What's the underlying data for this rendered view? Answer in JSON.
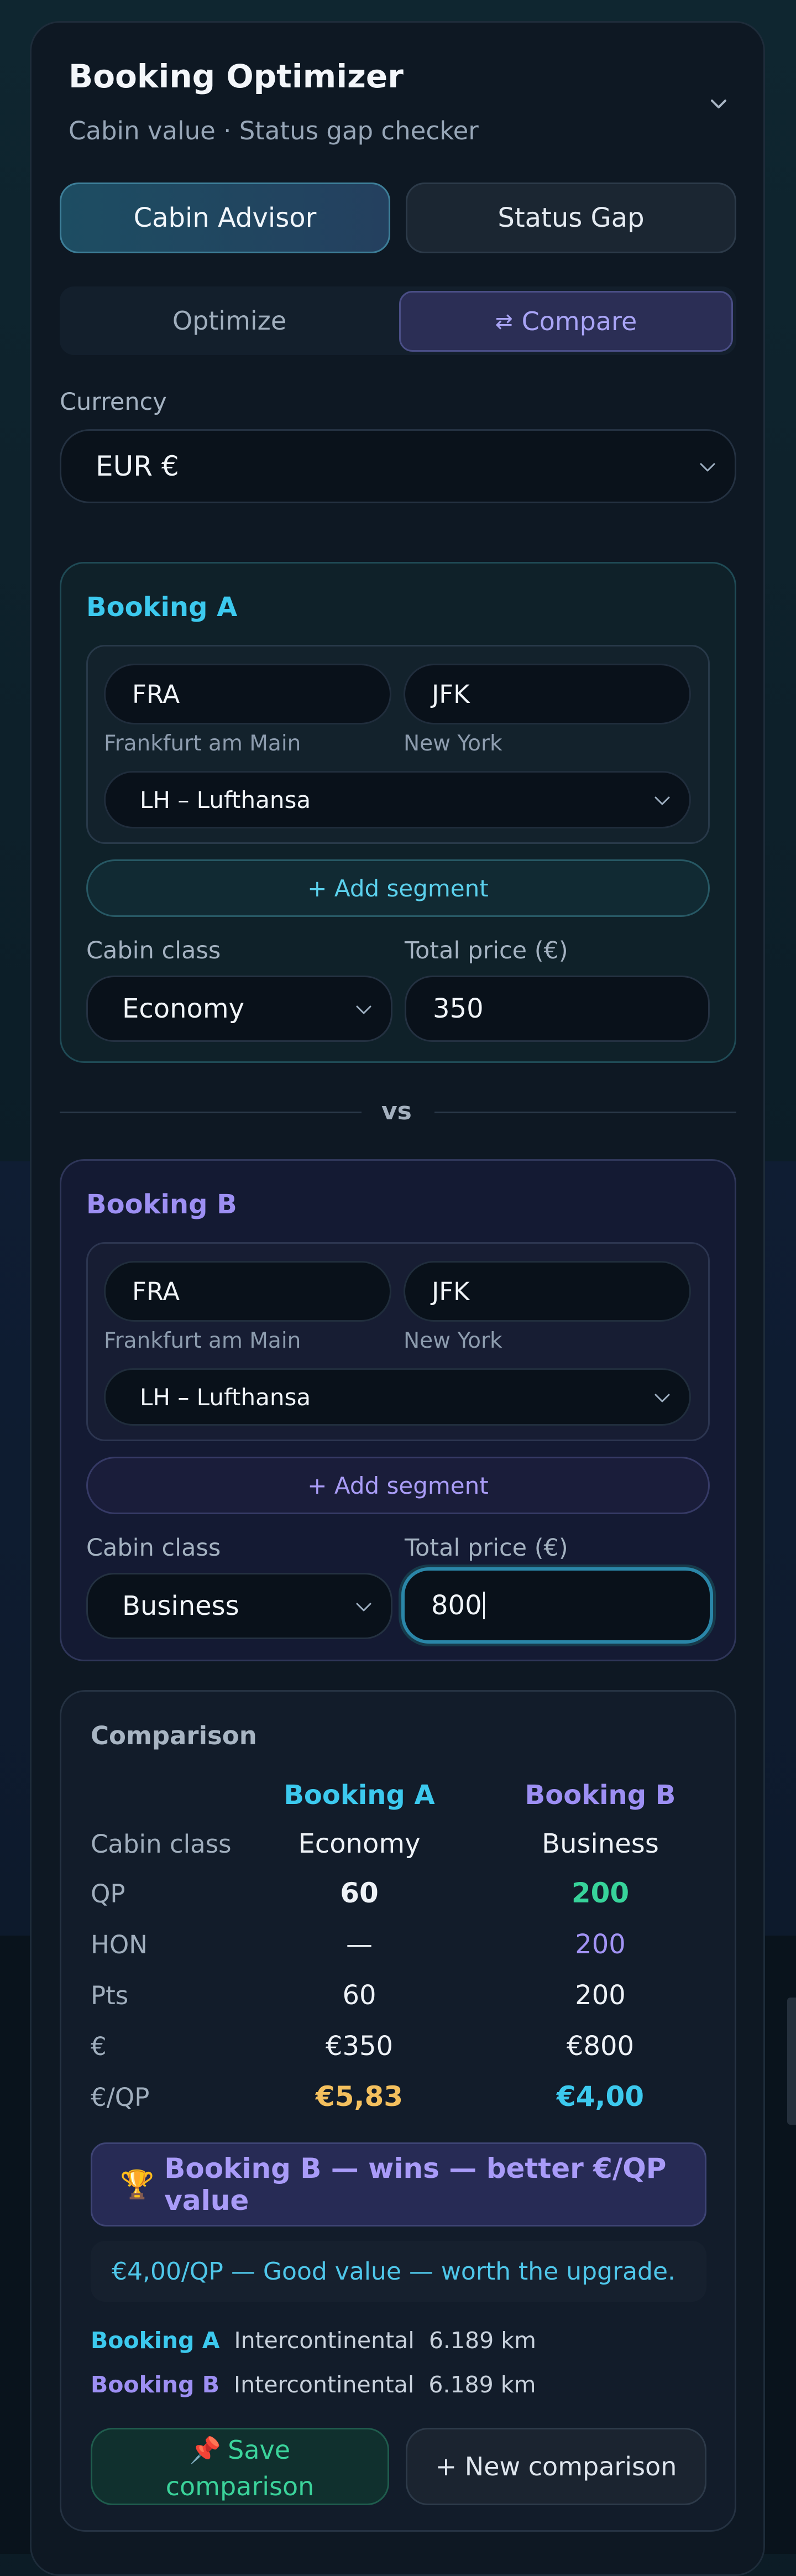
{
  "header": {
    "title": "Booking Optimizer",
    "subtitle": "Cabin value · Status gap checker",
    "collapse_icon": "chevron-down-icon"
  },
  "tabs": {
    "cabin_advisor": "Cabin Advisor",
    "status_gap": "Status Gap",
    "active": "Cabin Advisor"
  },
  "mode": {
    "optimize": "Optimize",
    "compare_icon": "⇄",
    "compare": "Compare",
    "active": "Compare"
  },
  "currency": {
    "label": "Currency",
    "value": "EUR €"
  },
  "booking_a": {
    "title": "Booking A",
    "origin": "FRA",
    "origin_city": "Frankfurt am Main",
    "destination": "JFK",
    "destination_city": "New York",
    "airline": "LH – Lufthansa",
    "add_segment": "+ Add segment",
    "cabin_label": "Cabin class",
    "cabin": "Economy",
    "price_label": "Total price (€)",
    "price": "350"
  },
  "vs": "vs",
  "booking_b": {
    "title": "Booking B",
    "origin": "FRA",
    "origin_city": "Frankfurt am Main",
    "destination": "JFK",
    "destination_city": "New York",
    "airline": "LH – Lufthansa",
    "add_segment": "+ Add segment",
    "cabin_label": "Cabin class",
    "cabin": "Business",
    "price_label": "Total price (€)",
    "price": "800"
  },
  "comparison": {
    "title": "Comparison",
    "col_a": "Booking A",
    "col_b": "Booking B",
    "rows": [
      {
        "label": "Cabin class",
        "a": "Economy",
        "b": "Business"
      },
      {
        "label": "QP",
        "a": "60",
        "b": "200"
      },
      {
        "label": "HON",
        "a": "—",
        "b": "200"
      },
      {
        "label": "Pts",
        "a": "60",
        "b": "200"
      },
      {
        "label": "€",
        "a": "€350",
        "b": "€800"
      },
      {
        "label": "€/QP",
        "a": "€5,83",
        "b": "€4,00"
      }
    ],
    "winner_icon": "🏆",
    "winner": "Booking B — wins — better €/QP value",
    "value_note": "€4,00/QP — Good value — worth the upgrade.",
    "route_a": {
      "tag": "Booking A",
      "region": "Intercontinental",
      "distance": "6.189 km"
    },
    "route_b": {
      "tag": "Booking B",
      "region": "Intercontinental",
      "distance": "6.189 km"
    },
    "save_icon": "📌",
    "save_line1": "Save",
    "save_line2": "comparison",
    "new_comparison": "+ New comparison"
  },
  "colors": {
    "accent_a": "#3cc9ee",
    "accent_b": "#9d8ff3",
    "good": "#37d39a",
    "warn": "#f4c05e"
  }
}
